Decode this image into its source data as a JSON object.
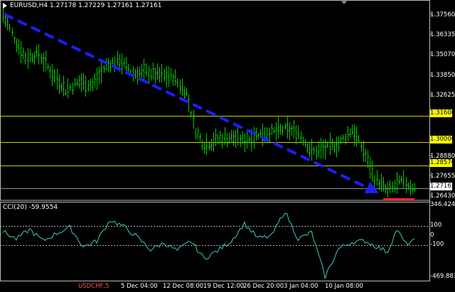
{
  "header": {
    "symbol_info": "EURUSD,H4",
    "ohlc": "1.27178 1.27229 1.27161 1.27161"
  },
  "indicator": {
    "name": "CCI(20)",
    "value": "-59.9554"
  },
  "price_axis": {
    "labels": [
      "1.37560",
      "1.36335",
      "1.35070",
      "1.33850",
      "1.32625",
      "1.28880",
      "1.27655",
      "1.26430"
    ],
    "level_boxes": [
      "1.31600",
      "1.30000",
      "1.28570"
    ],
    "current_price": "1.27161"
  },
  "cci_axis": {
    "labels": [
      "346.4245",
      "100",
      "0",
      "-100",
      "-469.8834"
    ]
  },
  "time_axis": {
    "labels": [
      "5 Dec 04:00",
      "12 Dec 08:00",
      "19 Dec 12:00",
      "26 Dec 20:00",
      "3 Jan 04:00",
      "10 Jan 08:00"
    ],
    "faded_label": "USDCHF,5"
  },
  "colors": {
    "background": "#000000",
    "bars": "#00cc00",
    "level_lines": "#cccc00",
    "level_box": "#ffff00",
    "trend_arrow": "#1e1eff",
    "support_mark": "#ff2020",
    "cci_line": "#40c8c0",
    "current_price_box": "#ffffff"
  },
  "chart_data": {
    "type": "line",
    "symbol": "EURUSD",
    "timeframe": "H4",
    "horizontal_levels": [
      1.316,
      1.3,
      1.2857
    ],
    "current_price": 1.27161,
    "price_ylim": [
      1.2643,
      1.381
    ],
    "price_path": [
      {
        "t": 0,
        "v": 1.378
      },
      {
        "t": 3,
        "v": 1.361
      },
      {
        "t": 5,
        "v": 1.352
      },
      {
        "t": 8,
        "v": 1.354
      },
      {
        "t": 11,
        "v": 1.342
      },
      {
        "t": 14,
        "v": 1.332
      },
      {
        "t": 17,
        "v": 1.337
      },
      {
        "t": 20,
        "v": 1.335
      },
      {
        "t": 23,
        "v": 1.347
      },
      {
        "t": 26,
        "v": 1.35
      },
      {
        "t": 29,
        "v": 1.342
      },
      {
        "t": 32,
        "v": 1.343
      },
      {
        "t": 35,
        "v": 1.341
      },
      {
        "t": 38,
        "v": 1.34
      },
      {
        "t": 41,
        "v": 1.33
      },
      {
        "t": 43,
        "v": 1.307
      },
      {
        "t": 45,
        "v": 1.298
      },
      {
        "t": 48,
        "v": 1.302
      },
      {
        "t": 51,
        "v": 1.303
      },
      {
        "t": 54,
        "v": 1.301
      },
      {
        "t": 57,
        "v": 1.305
      },
      {
        "t": 60,
        "v": 1.306
      },
      {
        "t": 63,
        "v": 1.308
      },
      {
        "t": 66,
        "v": 1.306
      },
      {
        "t": 69,
        "v": 1.294
      },
      {
        "t": 72,
        "v": 1.296
      },
      {
        "t": 75,
        "v": 1.299
      },
      {
        "t": 78,
        "v": 1.308
      },
      {
        "t": 81,
        "v": 1.292
      },
      {
        "t": 83,
        "v": 1.278
      },
      {
        "t": 86,
        "v": 1.27
      },
      {
        "t": 89,
        "v": 1.276
      },
      {
        "t": 92,
        "v": 1.2716
      }
    ],
    "cci_ylim": [
      -469.8834,
      346.4245
    ],
    "cci_levels": [
      100,
      0,
      -100
    ],
    "cci_path": [
      {
        "t": 0,
        "v": 40
      },
      {
        "t": 3,
        "v": -40
      },
      {
        "t": 6,
        "v": 60
      },
      {
        "t": 9,
        "v": -60
      },
      {
        "t": 12,
        "v": 20
      },
      {
        "t": 15,
        "v": 80
      },
      {
        "t": 18,
        "v": -120
      },
      {
        "t": 21,
        "v": -60
      },
      {
        "t": 24,
        "v": 160
      },
      {
        "t": 27,
        "v": 90
      },
      {
        "t": 30,
        "v": -20
      },
      {
        "t": 33,
        "v": -150
      },
      {
        "t": 36,
        "v": -80
      },
      {
        "t": 39,
        "v": -160
      },
      {
        "t": 42,
        "v": -60
      },
      {
        "t": 45,
        "v": -240
      },
      {
        "t": 48,
        "v": -160
      },
      {
        "t": 51,
        "v": -60
      },
      {
        "t": 54,
        "v": 120
      },
      {
        "t": 57,
        "v": -30
      },
      {
        "t": 60,
        "v": -10
      },
      {
        "t": 63,
        "v": 250
      },
      {
        "t": 66,
        "v": -40
      },
      {
        "t": 69,
        "v": 30
      },
      {
        "t": 72,
        "v": -430
      },
      {
        "t": 75,
        "v": -140
      },
      {
        "t": 78,
        "v": -70
      },
      {
        "t": 81,
        "v": -60
      },
      {
        "t": 84,
        "v": -130
      },
      {
        "t": 86,
        "v": -170
      },
      {
        "t": 88,
        "v": 60
      },
      {
        "t": 90,
        "v": -90
      },
      {
        "t": 92,
        "v": -60
      }
    ]
  }
}
